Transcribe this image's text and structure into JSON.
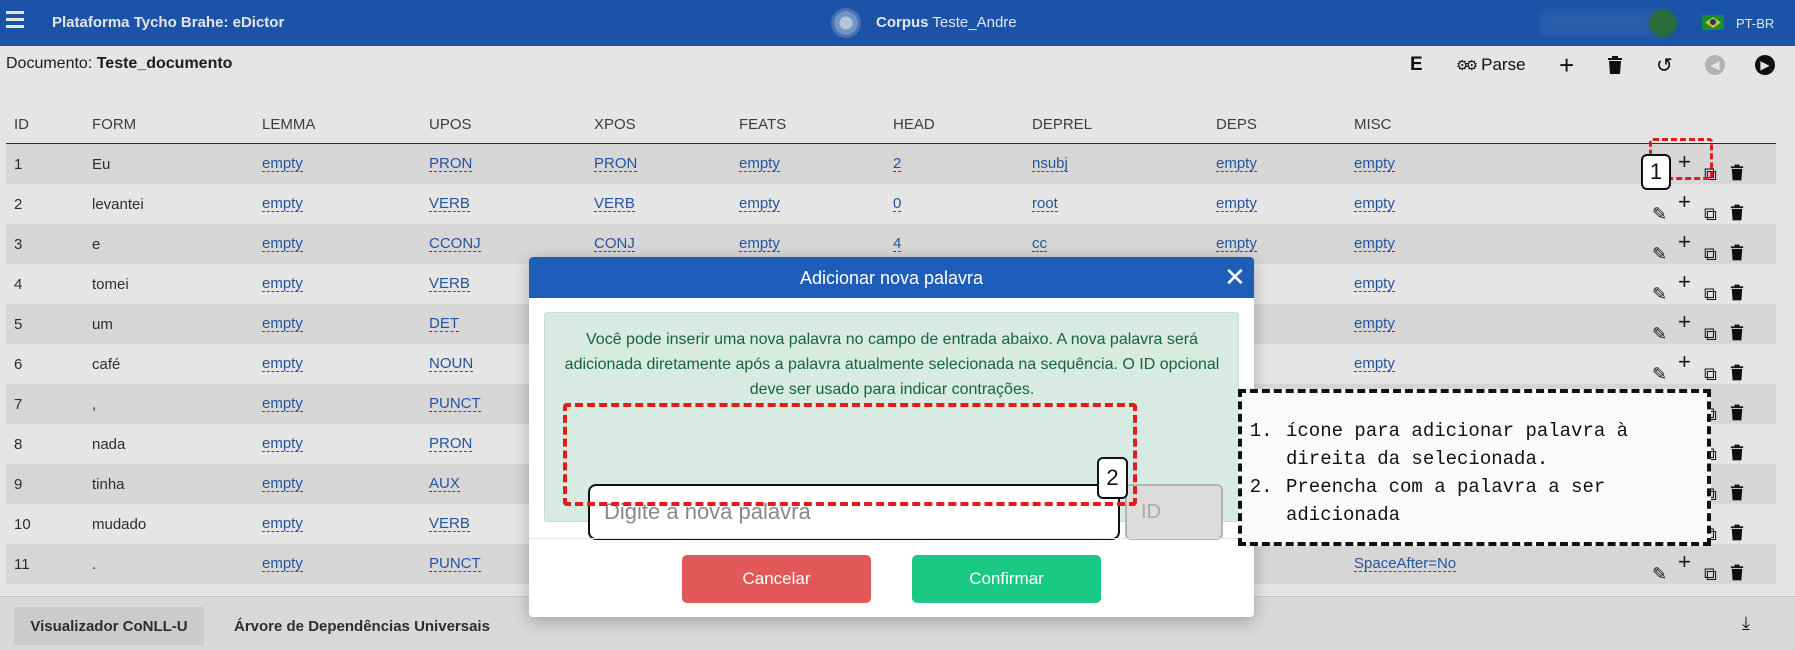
{
  "topbar": {
    "app_title": "Plataforma Tycho Brahe: eDictor",
    "corpus_label": "Corpus",
    "corpus_name": "Teste_Andre",
    "language": "PT-BR"
  },
  "document": {
    "label": "Documento:",
    "name": "Teste_documento",
    "toolbar": {
      "e_label": "E",
      "parse_label": "Parse"
    }
  },
  "table": {
    "headers": [
      "ID",
      "FORM",
      "LEMMA",
      "UPOS",
      "XPOS",
      "FEATS",
      "HEAD",
      "DEPREL",
      "DEPS",
      "MISC"
    ],
    "rows": [
      {
        "id": "1",
        "form": "Eu",
        "lemma": "empty",
        "upos": "PRON",
        "xpos": "PRON",
        "feats": "empty",
        "head": "2",
        "deprel": "nsubj",
        "deps": "empty",
        "misc": "empty"
      },
      {
        "id": "2",
        "form": "levantei",
        "lemma": "empty",
        "upos": "VERB",
        "xpos": "VERB",
        "feats": "empty",
        "head": "0",
        "deprel": "root",
        "deps": "empty",
        "misc": "empty"
      },
      {
        "id": "3",
        "form": "e",
        "lemma": "empty",
        "upos": "CCONJ",
        "xpos": "CONJ",
        "feats": "empty",
        "head": "4",
        "deprel": "cc",
        "deps": "empty",
        "misc": "empty"
      },
      {
        "id": "4",
        "form": "tomei",
        "lemma": "empty",
        "upos": "VERB",
        "misc": "empty"
      },
      {
        "id": "5",
        "form": "um",
        "lemma": "empty",
        "upos": "DET",
        "misc": "empty"
      },
      {
        "id": "6",
        "form": "café",
        "lemma": "empty",
        "upos": "NOUN",
        "misc": "empty"
      },
      {
        "id": "7",
        "form": ",",
        "lemma": "empty",
        "upos": "PUNCT"
      },
      {
        "id": "8",
        "form": "nada",
        "lemma": "empty",
        "upos": "PRON"
      },
      {
        "id": "9",
        "form": "tinha",
        "lemma": "empty",
        "upos": "AUX"
      },
      {
        "id": "10",
        "form": "mudado",
        "lemma": "empty",
        "upos": "VERB"
      },
      {
        "id": "11",
        "form": ".",
        "lemma": "empty",
        "upos": "PUNCT",
        "misc": "SpaceAfter=No"
      }
    ]
  },
  "bottom_tabs": {
    "conll": "Visualizador CoNLL-U",
    "tree": "Árvore de Dependências Universais"
  },
  "modal": {
    "title": "Adicionar nova palavra",
    "info": "Você pode inserir uma nova palavra no campo de entrada abaixo. A nova palavra será adicionada diretamente após a palavra atualmente selecionada na sequência. O ID opcional deve ser usado para indicar contrações.",
    "word_placeholder": "Digite a nova palavra",
    "id_placeholder": "ID",
    "cancel": "Cancelar",
    "confirm": "Confirmar"
  },
  "annotations": {
    "badge_1": "1",
    "badge_2": "2",
    "notes": [
      "ícone para adicionar palavra à direita da selecionada.",
      "Preencha com a palavra a ser adicionada"
    ]
  },
  "colors": {
    "primary": "#1f5dbb",
    "link": "#2a5db0",
    "cancel": "#e25858",
    "confirm": "#19c985",
    "info_bg": "#d7ebe2",
    "annotation_red": "#e31b1b"
  }
}
